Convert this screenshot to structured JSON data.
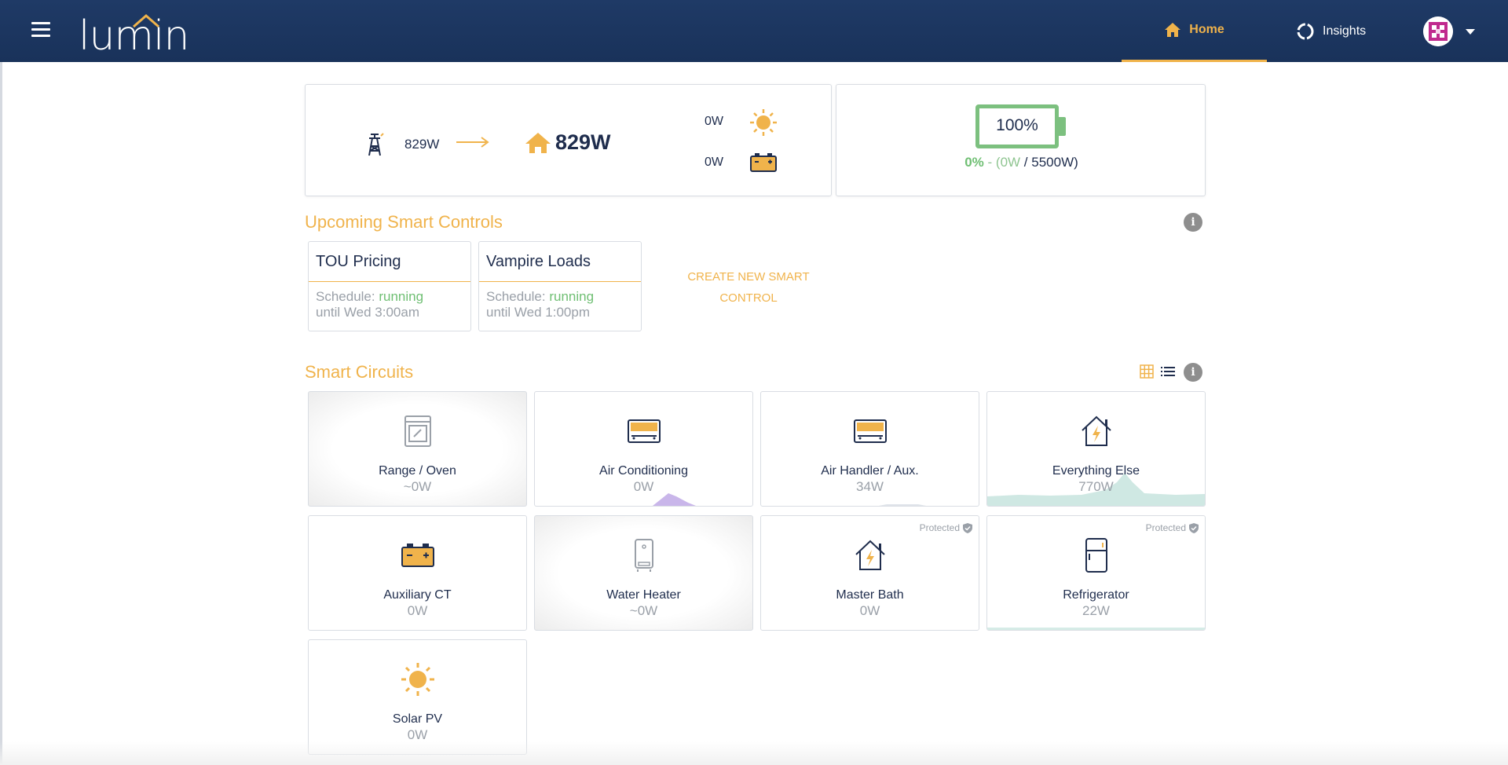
{
  "app": {
    "logo_text": "lumin"
  },
  "nav": {
    "home_label": "Home",
    "insights_label": "Insights"
  },
  "flow": {
    "grid_value": "829W",
    "home_value": "829W",
    "solar_value": "0W",
    "battery_value": "0W"
  },
  "battery": {
    "percent": "100%",
    "level_fraction": 1.0,
    "rate": "0%",
    "sep": " - (",
    "power": "0W",
    "slash": " / ",
    "capacity": "5500W)"
  },
  "smart_controls": {
    "title": "Upcoming Smart Controls",
    "items": [
      {
        "name": "TOU Pricing",
        "schedule_prefix": "Schedule: ",
        "status": "running",
        "until": "until Wed 3:00am"
      },
      {
        "name": "Vampire Loads",
        "schedule_prefix": "Schedule: ",
        "status": "running",
        "until": "until Wed 1:00pm"
      }
    ],
    "create_line1": "CREATE NEW SMART",
    "create_line2": "CONTROL"
  },
  "smart_circuits": {
    "title": "Smart Circuits",
    "protected_label": "Protected",
    "items": [
      {
        "name": "Range / Oven",
        "value": "~0W",
        "icon": "oven-icon",
        "state": "off"
      },
      {
        "name": "Air Conditioning",
        "value": "0W",
        "icon": "battery-unit-icon",
        "state": "on"
      },
      {
        "name": "Air Handler / Aux.",
        "value": "34W",
        "icon": "battery-unit-icon",
        "state": "on"
      },
      {
        "name": "Everything Else",
        "value": "770W",
        "icon": "house-bolt-icon",
        "state": "on"
      },
      {
        "name": "Auxiliary CT",
        "value": "0W",
        "icon": "battery-icon",
        "state": "on"
      },
      {
        "name": "Water Heater",
        "value": "~0W",
        "icon": "water-heater-icon",
        "state": "off"
      },
      {
        "name": "Master Bath",
        "value": "0W",
        "icon": "house-bolt-icon",
        "state": "protected"
      },
      {
        "name": "Refrigerator",
        "value": "22W",
        "icon": "refrigerator-icon",
        "state": "protected"
      },
      {
        "name": "Solar PV",
        "value": "0W",
        "icon": "sun-icon",
        "state": "on"
      }
    ]
  },
  "colors": {
    "accent": "#f0b34b",
    "navy": "#1f2d4d",
    "green": "#6fbf73",
    "header": "#1f3a66"
  }
}
